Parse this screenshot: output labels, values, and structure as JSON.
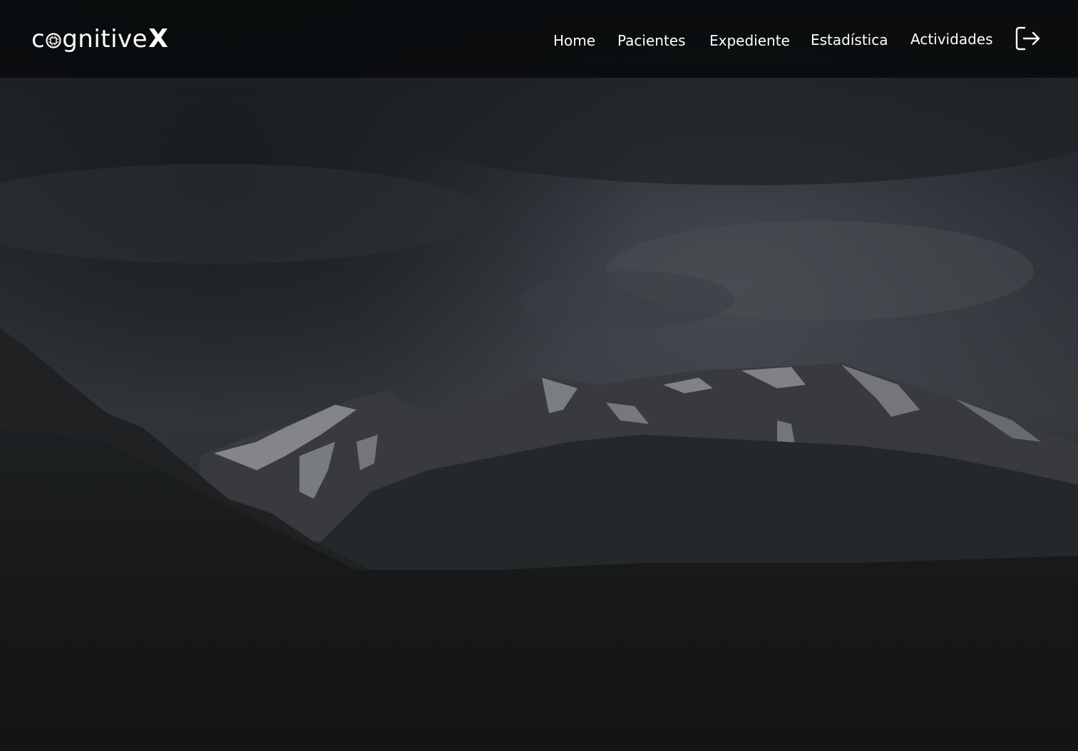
{
  "brand": {
    "logo_prefix": "c",
    "logo_middle": "gnitive",
    "logo_suffix": "X"
  },
  "nav": {
    "items": [
      {
        "label": "Home"
      },
      {
        "label": "Pacientes"
      },
      {
        "label": "Expediente"
      },
      {
        "label": "Estadística"
      },
      {
        "label": "Actividades"
      }
    ],
    "logout_icon": "logout-icon"
  },
  "colors": {
    "nav_text": "#ffffff",
    "topbar_bg": "#0a0c0e",
    "page_bg": "#151515"
  }
}
